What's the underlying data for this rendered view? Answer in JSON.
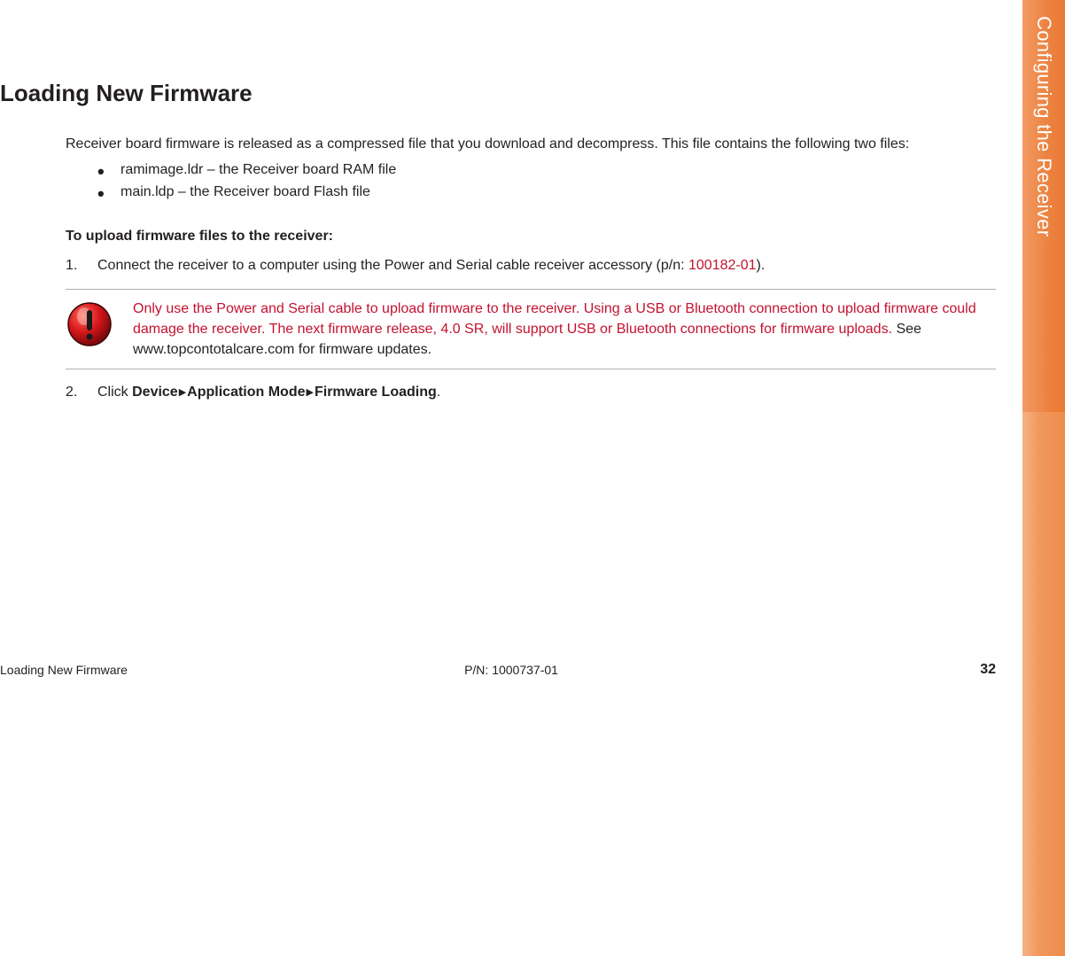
{
  "sidebar": {
    "chapter_title": "Configuring the Receiver"
  },
  "section": {
    "title": "Loading New Firmware",
    "intro": "Receiver board firmware is released as a compressed file that you download and decompress. This file contains the following two files:",
    "bullets": [
      "ramimage.ldr – the Receiver board RAM file",
      "main.ldp – the Receiver board Flash file"
    ],
    "upload_heading": "To upload firmware files to the receiver:",
    "step1": {
      "text_prefix": "Connect the receiver to a computer using the Power and Serial cable receiver accessory (p/n: ",
      "part_number": "100182-01",
      "text_suffix": ")."
    },
    "callout": {
      "warning": "Only use the Power and Serial cable to upload firmware to the receiver. Using a USB or Bluetooth connection to upload firmware could damage the receiver. The next firmware release, 4.0 SR, will support USB or Bluetooth connections for firmware uploads.",
      "followup": " See www.topcontotalcare.com for firmware updates."
    },
    "step2": {
      "prefix": "Click ",
      "path": [
        "Device",
        "Application Mode",
        "Firmware Loading"
      ],
      "suffix": "."
    }
  },
  "footer": {
    "left": "Loading New Firmware",
    "center": "P/N: 1000737-01",
    "page_number": "32"
  }
}
